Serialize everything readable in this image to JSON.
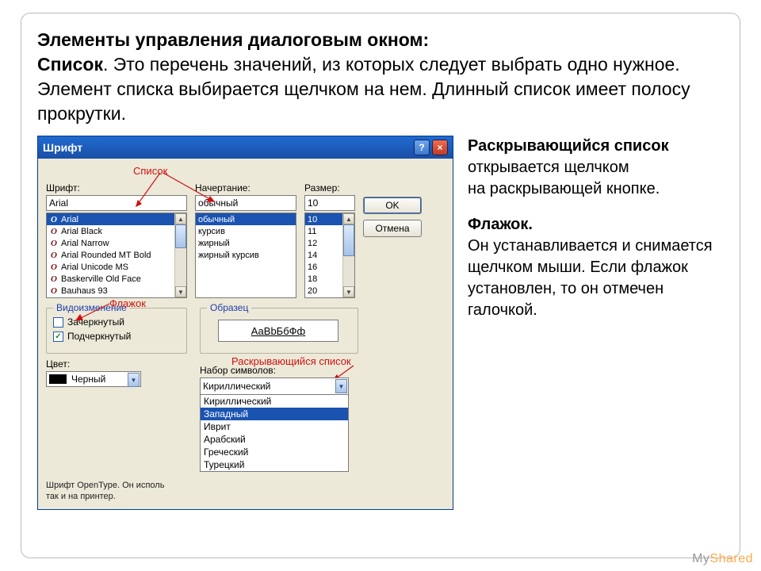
{
  "headline": {
    "title": "Элементы управления диалоговым окном:",
    "body_bold": "Список",
    "body_rest": ". Это перечень значений, из которых следует выбрать одно нужное. Элемент списка выбирается щелчком на нем. Длинный список имеет полосу прокрутки."
  },
  "dialog": {
    "title": "Шрифт",
    "help": "?",
    "close": "×",
    "font_label": "Шрифт:",
    "font_value": "Arial",
    "font_list": [
      "Arial",
      "Arial Black",
      "Arial Narrow",
      "Arial Rounded MT Bold",
      "Arial Unicode MS",
      "Baskerville Old Face",
      "Bauhaus 93"
    ],
    "style_label": "Начертание:",
    "style_value": "обычный",
    "style_list": [
      "обычный",
      "курсив",
      "жирный",
      "жирный курсив"
    ],
    "size_label": "Размер:",
    "size_value": "10",
    "size_list": [
      "10",
      "11",
      "12",
      "14",
      "16",
      "18",
      "20"
    ],
    "ok": "OK",
    "cancel": "Отмена",
    "modify_group": "Видоизменение",
    "cb_strike": "Зачеркнутый",
    "cb_underline": "Подчеркнутый",
    "color_label": "Цвет:",
    "color_value": "Черный",
    "sample_group": "Образец",
    "sample_text": "АаBbБбФф",
    "charset_label": "Набор символов:",
    "charset_value": "Кириллический",
    "charset_list": [
      "Кириллический",
      "Западный",
      "Иврит",
      "Арабский",
      "Греческий",
      "Турецкий"
    ],
    "hint_line1": "Шрифт OpenType. Он исполь",
    "hint_line2": "так и на принтер."
  },
  "annotations": {
    "list": "Список",
    "checkbox": "Флажок",
    "dropdown": "Раскрывающийся список"
  },
  "side": {
    "p1_bold": "Раскрывающийся список",
    "p1_rest": " открывается щелчком",
    "p1b": " на раскрывающей кнопке.",
    "p2_bold": "Флажок.",
    "p2_rest": "Он устанавливается и снимается щелчком мыши. Если флажок установлен, то он отмечен галочкой."
  },
  "watermark": {
    "my": "My",
    "sh": "Shared"
  }
}
